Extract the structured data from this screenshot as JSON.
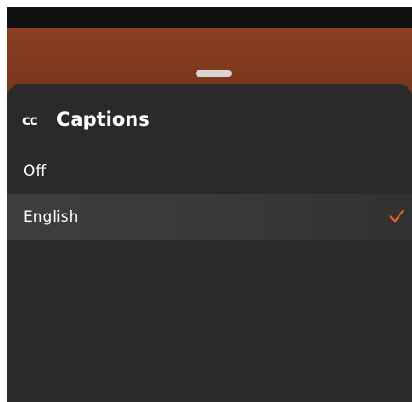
{
  "captions_sheet": {
    "title": "Captions",
    "icon": "closed-captions-icon",
    "options": [
      {
        "label": "Off",
        "selected": false
      },
      {
        "label": "English",
        "selected": true
      }
    ]
  },
  "colors": {
    "sheet_background": "#2b2929",
    "selected_row": "#3d3b3a",
    "accent_check": "#f2652d",
    "backdrop": "#8a3e22"
  }
}
